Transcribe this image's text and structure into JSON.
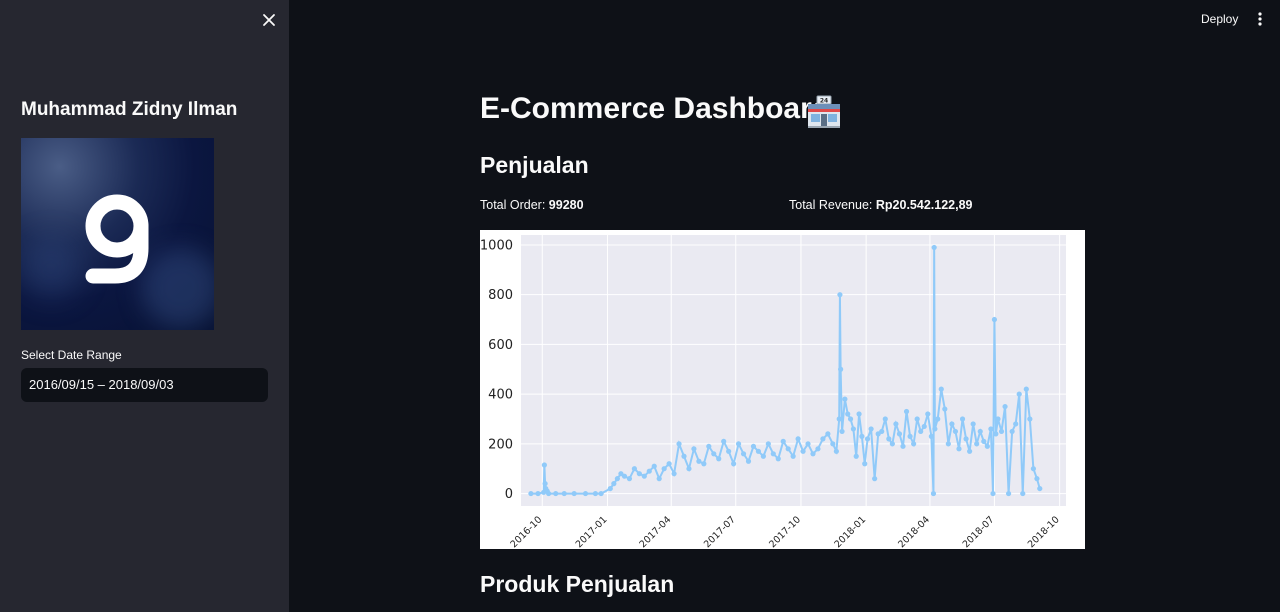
{
  "sidebar": {
    "close_icon": "close-icon",
    "title": "Muhammad Zidny Ilman",
    "logo_icon": "g-logo-icon",
    "date_label": "Select Date Range",
    "date_value": "2016/09/15 – 2018/09/03"
  },
  "header": {
    "deploy_label": "Deploy",
    "menu_icon": "vertical-dots-icon"
  },
  "main": {
    "title": "E-Commerce Dashboard",
    "title_icon": "convenience-store-emoji-icon",
    "section_sales": "Penjualan",
    "total_order_label": "Total Order:",
    "total_order_value": "99280",
    "total_revenue_label": "Total Revenue:",
    "total_revenue_value": "Rp20.542.122,89",
    "section_products": "Produk Penjualan"
  },
  "colors": {
    "background": "#0e1117",
    "sidebar": "#262730",
    "plot_bg": "#eaeaf2",
    "line": "#90caf9"
  },
  "chart_data": {
    "type": "line",
    "title": "",
    "xlabel": "",
    "ylabel": "",
    "ylim": [
      -50,
      1040
    ],
    "yticks": [
      0,
      200,
      400,
      600,
      800,
      1000
    ],
    "xticks": [
      "2016-10",
      "2017-01",
      "2017-04",
      "2017-07",
      "2017-10",
      "2018-01",
      "2018-04",
      "2018-07",
      "2018-10"
    ],
    "grid": true,
    "series": [
      {
        "values_note_free": true,
        "x": [
          "2016-09-15",
          "2016-09-25",
          "2016-10-03",
          "2016-10-04",
          "2016-10-05",
          "2016-10-06",
          "2016-10-08",
          "2016-10-10",
          "2016-10-20",
          "2016-11-01",
          "2016-11-15",
          "2016-12-01",
          "2016-12-15",
          "2016-12-23",
          "2017-01-05",
          "2017-01-10",
          "2017-01-15",
          "2017-01-20",
          "2017-01-25",
          "2017-02-01",
          "2017-02-08",
          "2017-02-15",
          "2017-02-22",
          "2017-03-01",
          "2017-03-08",
          "2017-03-15",
          "2017-03-22",
          "2017-03-29",
          "2017-04-05",
          "2017-04-12",
          "2017-04-19",
          "2017-04-26",
          "2017-05-03",
          "2017-05-10",
          "2017-05-17",
          "2017-05-24",
          "2017-05-31",
          "2017-06-07",
          "2017-06-14",
          "2017-06-21",
          "2017-06-28",
          "2017-07-05",
          "2017-07-12",
          "2017-07-19",
          "2017-07-26",
          "2017-08-02",
          "2017-08-09",
          "2017-08-16",
          "2017-08-23",
          "2017-08-30",
          "2017-09-06",
          "2017-09-13",
          "2017-09-20",
          "2017-09-27",
          "2017-10-04",
          "2017-10-11",
          "2017-10-18",
          "2017-10-25",
          "2017-11-01",
          "2017-11-08",
          "2017-11-15",
          "2017-11-20",
          "2017-11-24",
          "2017-11-25",
          "2017-11-26",
          "2017-11-28",
          "2017-12-02",
          "2017-12-06",
          "2017-12-10",
          "2017-12-14",
          "2017-12-18",
          "2017-12-22",
          "2017-12-26",
          "2017-12-30",
          "2018-01-03",
          "2018-01-08",
          "2018-01-13",
          "2018-01-18",
          "2018-01-23",
          "2018-01-28",
          "2018-02-02",
          "2018-02-07",
          "2018-02-12",
          "2018-02-17",
          "2018-02-22",
          "2018-02-27",
          "2018-03-04",
          "2018-03-09",
          "2018-03-14",
          "2018-03-19",
          "2018-03-24",
          "2018-03-29",
          "2018-04-03",
          "2018-04-06",
          "2018-04-07",
          "2018-04-08",
          "2018-04-12",
          "2018-04-17",
          "2018-04-22",
          "2018-04-27",
          "2018-05-02",
          "2018-05-07",
          "2018-05-12",
          "2018-05-17",
          "2018-05-22",
          "2018-05-27",
          "2018-06-01",
          "2018-06-06",
          "2018-06-11",
          "2018-06-16",
          "2018-06-21",
          "2018-06-26",
          "2018-06-29",
          "2018-07-01",
          "2018-07-03",
          "2018-07-06",
          "2018-07-11",
          "2018-07-16",
          "2018-07-21",
          "2018-07-26",
          "2018-07-31",
          "2018-08-05",
          "2018-08-10",
          "2018-08-15",
          "2018-08-20",
          "2018-08-25",
          "2018-08-30",
          "2018-09-03"
        ],
        "y": [
          0,
          0,
          5,
          115,
          40,
          20,
          10,
          0,
          0,
          0,
          0,
          0,
          0,
          0,
          20,
          40,
          60,
          80,
          70,
          60,
          100,
          80,
          70,
          90,
          110,
          60,
          100,
          120,
          80,
          200,
          150,
          100,
          180,
          130,
          120,
          190,
          160,
          140,
          210,
          170,
          120,
          200,
          160,
          130,
          190,
          170,
          150,
          200,
          160,
          140,
          210,
          180,
          150,
          220,
          170,
          200,
          160,
          180,
          220,
          240,
          200,
          170,
          300,
          800,
          500,
          250,
          380,
          320,
          300,
          260,
          150,
          320,
          230,
          120,
          220,
          260,
          60,
          240,
          250,
          300,
          220,
          200,
          280,
          240,
          190,
          330,
          230,
          200,
          300,
          250,
          270,
          320,
          230,
          0,
          990,
          260,
          300,
          420,
          340,
          200,
          280,
          250,
          180,
          300,
          220,
          170,
          280,
          200,
          250,
          210,
          190,
          260,
          0,
          700,
          240,
          300,
          250,
          350,
          0,
          250,
          280,
          400,
          0,
          420,
          300,
          100,
          60,
          20
        ]
      }
    ]
  }
}
